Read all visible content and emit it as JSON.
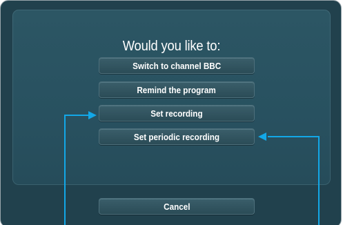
{
  "dialog": {
    "title": "Would you like to:",
    "options": [
      "Switch to channel BBC",
      "Remind the program",
      "Set recording",
      "Set periodic recording"
    ],
    "cancel_label": "Cancel"
  },
  "colors": {
    "frame_bg": "#21414d",
    "dialog_bg": "#2a5362",
    "button_bg": "#34575f",
    "callout": "#12a8e8"
  }
}
